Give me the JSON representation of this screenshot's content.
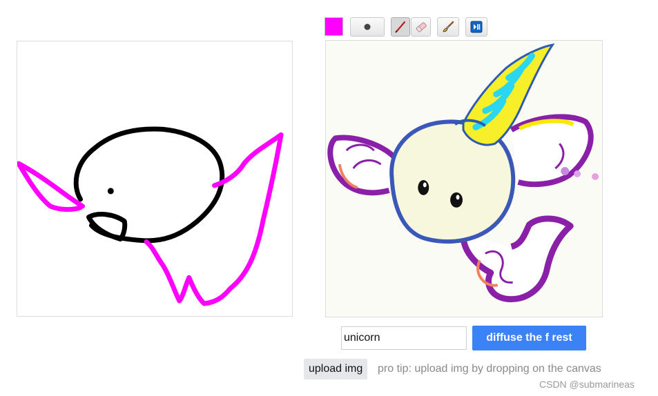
{
  "toolbar": {
    "color": "#ff00ff",
    "brush_icon": "dot-icon",
    "tools": [
      {
        "name": "pen-icon",
        "active": true
      },
      {
        "name": "eraser-icon",
        "active": false
      },
      {
        "name": "brush-icon",
        "active": false
      },
      {
        "name": "play-pause-icon",
        "active": false
      }
    ]
  },
  "prompt": {
    "value": "unicorn"
  },
  "actions": {
    "diffuse_label": "diffuse the f rest",
    "upload_label": "upload img",
    "tip": "pro tip: upload img by dropping on the canvas"
  },
  "watermark": "CSDN @submarineas",
  "colors": {
    "accent": "#3b82f6",
    "stroke_black": "#000000",
    "stroke_magenta": "#ff00ff"
  }
}
